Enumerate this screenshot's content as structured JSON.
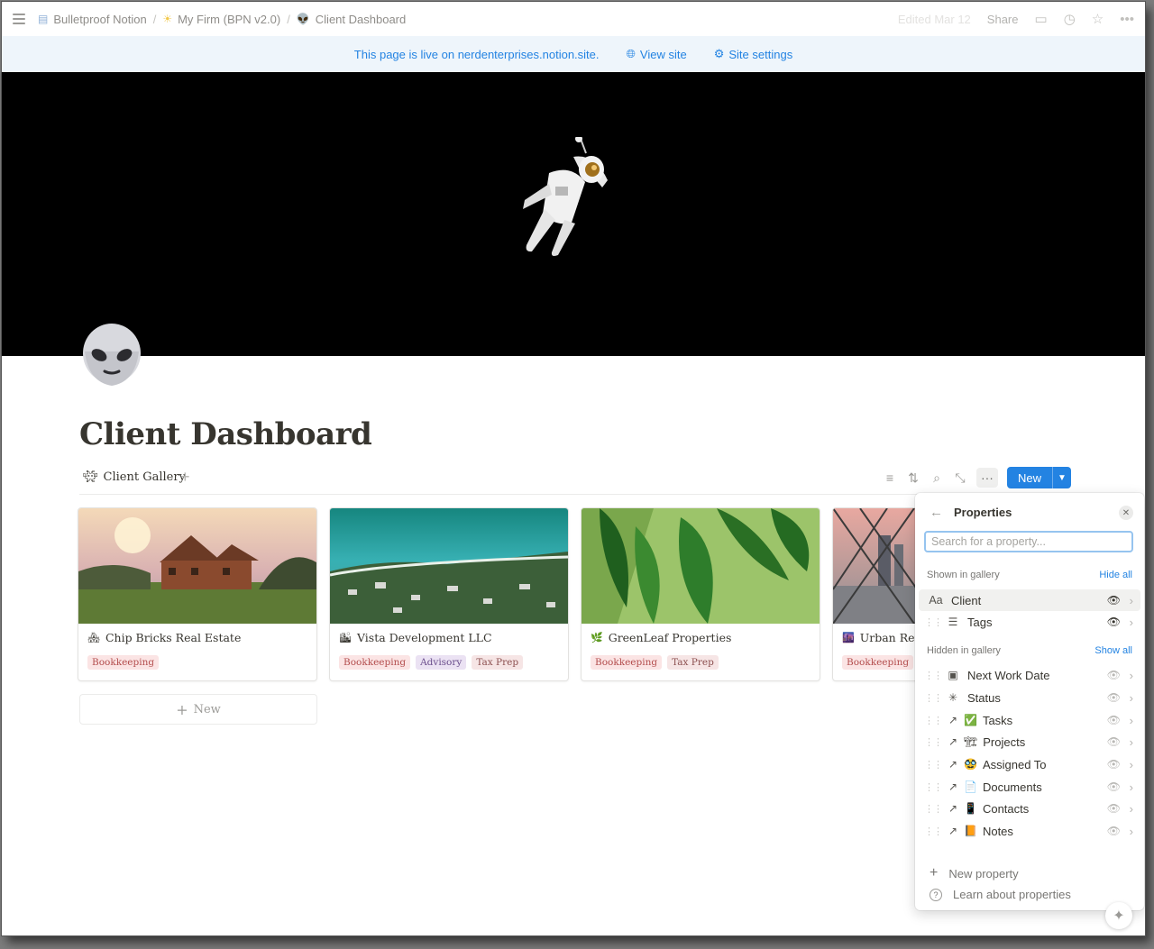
{
  "breadcrumbs": [
    {
      "icon": "database-icon",
      "label": "Bulletproof Notion"
    },
    {
      "icon": "sun-emoji-icon",
      "label": "My Firm (BPN v2.0)"
    },
    {
      "icon": "alien-icon",
      "label": "Client Dashboard"
    }
  ],
  "topbar": {
    "edited": "Edited Mar 12",
    "share": "Share"
  },
  "banner": {
    "message": "This page is live on nerdenterprises.notion.site.",
    "view_site": "View site",
    "site_settings": "Site settings"
  },
  "page": {
    "title": "Client Dashboard"
  },
  "view": {
    "tab_label": "Client Gallery",
    "new_button": "New"
  },
  "cards": [
    {
      "name": "Chip Bricks Real Estate",
      "tags": [
        "Bookkeeping"
      ]
    },
    {
      "name": "Vista Development LLC",
      "tags": [
        "Bookkeeping",
        "Advisory",
        "Tax Prep"
      ]
    },
    {
      "name": "GreenLeaf Properties",
      "tags": [
        "Bookkeeping",
        "Tax Prep"
      ]
    },
    {
      "name": "Urban Rene",
      "tags": [
        "Bookkeeping"
      ]
    }
  ],
  "new_card_label": "New",
  "properties_panel": {
    "title": "Properties",
    "search_placeholder": "Search for a property...",
    "shown_label": "Shown in gallery",
    "hide_all": "Hide all",
    "hidden_label": "Hidden in gallery",
    "show_all": "Show all",
    "shown": [
      {
        "type_icon": "Aa",
        "name": "Client"
      },
      {
        "type_icon": "list-icon",
        "name": "Tags"
      }
    ],
    "hidden": [
      {
        "type_icon": "calendar-icon",
        "name": "Next Work Date"
      },
      {
        "type_icon": "status-icon",
        "name": "Status"
      },
      {
        "type_icon": "relation-icon",
        "emoji": "✅",
        "name": "Tasks"
      },
      {
        "type_icon": "relation-icon",
        "emoji": "🏗",
        "name": "Projects"
      },
      {
        "type_icon": "relation-icon",
        "emoji": "🥸",
        "name": "Assigned To"
      },
      {
        "type_icon": "relation-icon",
        "emoji": "📄",
        "name": "Documents"
      },
      {
        "type_icon": "relation-icon",
        "emoji": "📱",
        "name": "Contacts"
      },
      {
        "type_icon": "relation-icon",
        "emoji": "📙",
        "name": "Notes"
      }
    ],
    "new_property": "New property",
    "learn_more": "Learn about properties"
  }
}
